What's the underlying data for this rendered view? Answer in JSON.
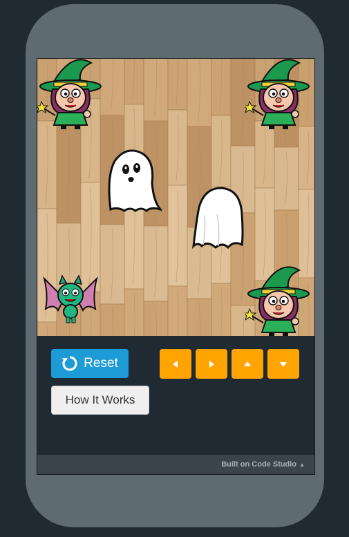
{
  "game": {
    "sprites": [
      {
        "kind": "witch",
        "name": "witch-top-left"
      },
      {
        "kind": "witch",
        "name": "witch-top-right"
      },
      {
        "kind": "ghost",
        "name": "ghost-face"
      },
      {
        "kind": "ghost",
        "name": "ghost-back"
      },
      {
        "kind": "bat",
        "name": "bat"
      },
      {
        "kind": "witch",
        "name": "witch-bottom-right"
      }
    ]
  },
  "controls": {
    "reset_label": "Reset",
    "reset_icon": "refresh-icon",
    "how_it_works_label": "How It Works",
    "arrows": [
      "arrow-left-icon",
      "arrow-right-icon",
      "arrow-up-icon",
      "arrow-down-icon"
    ]
  },
  "footer": {
    "built_on_label": "Built on Code Studio",
    "caret_icon": "caret-up-icon"
  },
  "colors": {
    "reset_button": "#1d9bd6",
    "arrow_button": "#ffa400",
    "phone_frame": "#5f6b73",
    "background": "#1f2a33",
    "wood_light": "#d7b68d",
    "witch_hat": "#1b9a4f"
  }
}
